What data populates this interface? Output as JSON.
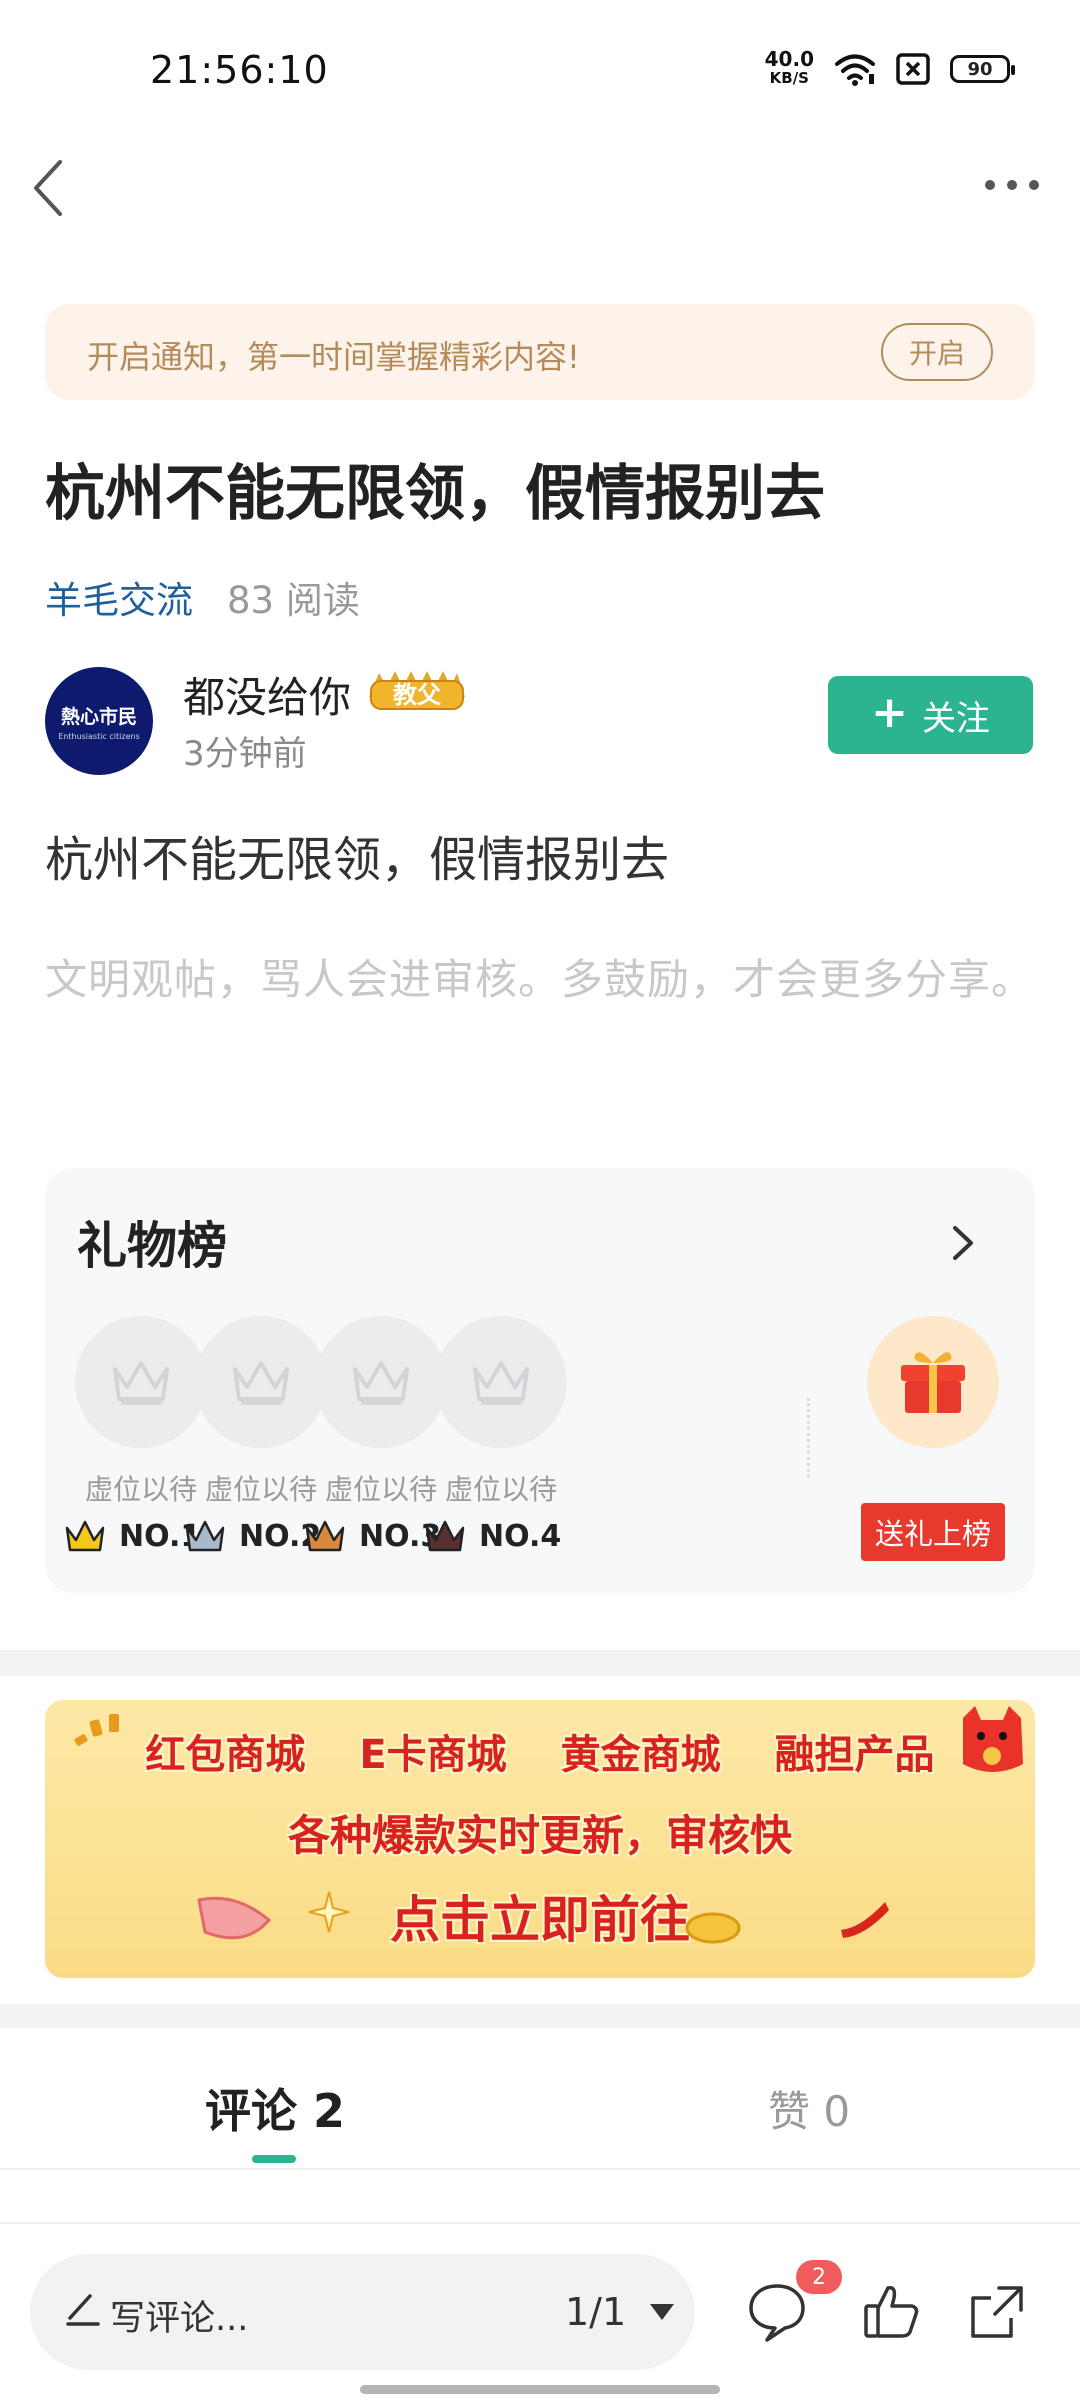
{
  "status_bar": {
    "time": "21:56:10",
    "net_speed_value": "40.0",
    "net_speed_unit": "KB/S",
    "battery": "90"
  },
  "notify": {
    "text": "开启通知，第一时间掌握精彩内容!",
    "button": "开启"
  },
  "post": {
    "title": "杭州不能无限领，假情报别去",
    "tag": "羊毛交流",
    "reads": "83 阅读",
    "body": "杭州不能无限领，假情报别去",
    "hint": "文明观帖，骂人会进审核。多鼓励，才会更多分享。"
  },
  "author": {
    "name": "都没给你",
    "badge": "教父",
    "time": "3分钟前",
    "avatar_text": "熱心市民",
    "avatar_sub": "Enthusiastic citizens",
    "follow_label": "关注"
  },
  "gift_board": {
    "title": "礼物榜",
    "slots": [
      {
        "label": "虚位以待",
        "rank": "NO.1",
        "crown_color": "#f2c81a"
      },
      {
        "label": "虚位以待",
        "rank": "NO.2",
        "crown_color": "#a9b9cc"
      },
      {
        "label": "虚位以待",
        "rank": "NO.3",
        "crown_color": "#d9883f"
      },
      {
        "label": "虚位以待",
        "rank": "NO.4",
        "crown_color": "#5a2f2f"
      }
    ],
    "send_label": "送礼上榜"
  },
  "promo": {
    "line1": [
      "红包商城",
      "E卡商城",
      "黄金商城",
      "融担产品"
    ],
    "line2": "各种爆款实时更新，审核快",
    "line3": "点击立即前往"
  },
  "tabs": {
    "comments": "评论 2",
    "likes": "赞 0"
  },
  "bottom_bar": {
    "placeholder": "写评论...",
    "page": "1/1",
    "comment_count": "2"
  },
  "colors": {
    "accent": "#2bb48f",
    "tag_blue": "#1f5f9c",
    "notify_text": "#b48c5c",
    "gift_red": "#e8392f"
  }
}
